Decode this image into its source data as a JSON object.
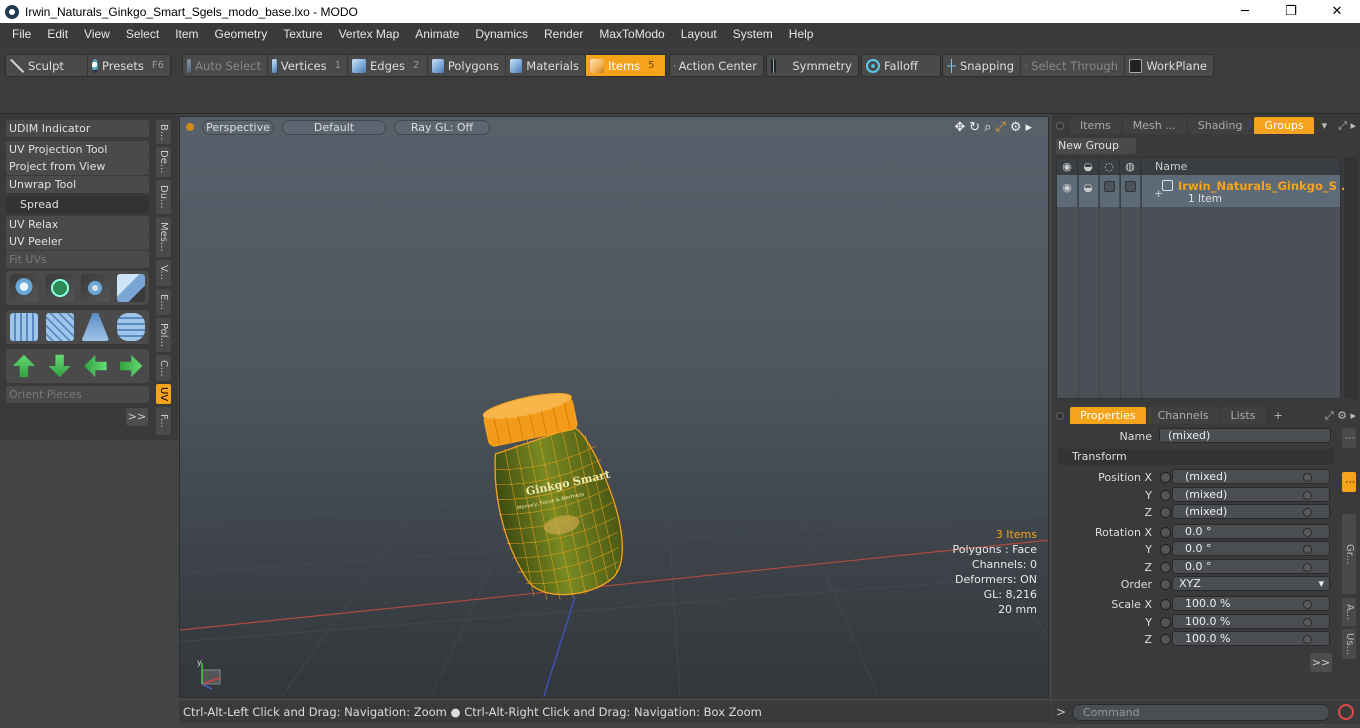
{
  "window": {
    "title": "Irwin_Naturals_Ginkgo_Smart_Sgels_modo_base.lxo - MODO",
    "minimize": "─",
    "maximize": "❐",
    "close": "✕"
  },
  "menu": [
    "File",
    "Edit",
    "View",
    "Select",
    "Item",
    "Geometry",
    "Texture",
    "Vertex Map",
    "Animate",
    "Dynamics",
    "Render",
    "MaxToModo",
    "Layout",
    "System",
    "Help"
  ],
  "toolbar": {
    "sculpt": "Sculpt",
    "presets": "Presets",
    "presets_key": "F6",
    "auto_select": "Auto Select",
    "vertices": "Vertices",
    "vertices_key": "1",
    "edges": "Edges",
    "edges_key": "2",
    "polygons": "Polygons",
    "materials": "Materials",
    "items": "Items",
    "items_key": "5",
    "action_center": "Action Center",
    "symmetry": "Symmetry",
    "falloff": "Falloff",
    "snapping": "Snapping",
    "select_through": "Select Through",
    "workplane": "WorkPlane"
  },
  "left_panel": {
    "udim_indicator": "UDIM Indicator",
    "uv_projection_tool": "UV Projection Tool",
    "project_from_view": "Project from View",
    "unwrap_tool": "Unwrap Tool",
    "spread": "Spread",
    "uv_relax": "UV Relax",
    "uv_peeler": "UV Peeler",
    "fit_uvs": "Fit UVs",
    "orient_pieces": "Orient Pieces",
    "more": ">>",
    "vtabs": [
      "B...",
      "De...",
      "Du...",
      "Mes...",
      "V...",
      "E...",
      "Pol...",
      "C...",
      "UV",
      "F..."
    ]
  },
  "viewport": {
    "perspective": "Perspective",
    "default": "Default",
    "raygl": "Ray GL: Off",
    "info_items": "3 Items",
    "info_polygons": "Polygons : Face",
    "info_channels": "Channels: 0",
    "info_deformers": "Deformers: ON",
    "info_gl": "GL: 8,216",
    "info_scale": "20 mm",
    "label_brand": "Ginkgo Smart",
    "label_sub": "Memory, Focus & Alertness"
  },
  "status": {
    "text": "Ctrl-Alt-Left Click and Drag: Navigation: Zoom ● Ctrl-Alt-Right Click and Drag: Navigation: Box Zoom"
  },
  "groups_panel": {
    "tabs": [
      "Items",
      "Mesh ...",
      "Shading",
      "Groups"
    ],
    "active_tab": "Groups",
    "new_group": "New Group",
    "col_name": "Name",
    "row_name": "Irwin_Naturals_Ginkgo_S ...",
    "row_count": "1 Item"
  },
  "properties_panel": {
    "tabs": [
      "Properties",
      "Channels",
      "Lists"
    ],
    "add_tab": "+",
    "name_label": "Name",
    "name_value": "(mixed)",
    "transform_section": "Transform",
    "position_x_label": "Position X",
    "position_x": "(mixed)",
    "position_y_label": "Y",
    "position_y": "(mixed)",
    "position_z_label": "Z",
    "position_z": "(mixed)",
    "rotation_x_label": "Rotation X",
    "rotation_x": "0.0 °",
    "rotation_y_label": "Y",
    "rotation_y": "0.0 °",
    "rotation_z_label": "Z",
    "rotation_z": "0.0 °",
    "order_label": "Order",
    "order_value": "XYZ",
    "scale_x_label": "Scale X",
    "scale_x": "100.0 %",
    "scale_y_label": "Y",
    "scale_y": "100.0 %",
    "scale_z_label": "Z",
    "scale_z": "100.0 %",
    "more": ">>",
    "side_tabs": [
      "Gr...",
      "A...",
      "Us..."
    ]
  },
  "command": {
    "prompt": ">",
    "placeholder": "Command"
  },
  "colors": {
    "accent": "#f5a31a",
    "wire": "#f5a31a",
    "bottle_green": "#6d7d1e"
  }
}
